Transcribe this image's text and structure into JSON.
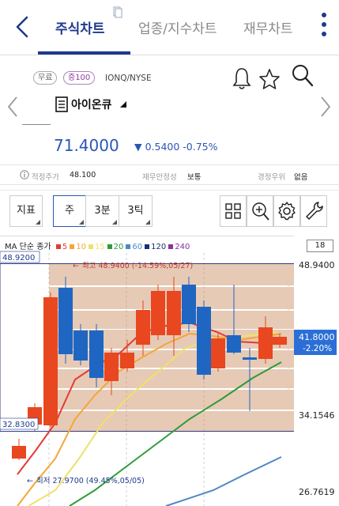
{
  "nav": {
    "tabs": [
      "주식차트",
      "업종/지수차트",
      "재무차트"
    ]
  },
  "info": {
    "badges": [
      "무료",
      "증100"
    ],
    "ticker": "IONQ/NYSE",
    "name": "아이온큐",
    "price": "71.4000",
    "change": "▼ 0.5400 -0.75%",
    "meta": [
      {
        "key": "적정주가",
        "value": "48.100"
      },
      {
        "key": "재무안정성",
        "value": "보통"
      },
      {
        "key": "경정우위",
        "value": "없음"
      }
    ]
  },
  "toolbar": {
    "indicator_label": "지표",
    "period_week": "주",
    "period_3min": "3분",
    "period_3tick": "3틱"
  },
  "chart": {
    "ma_title": "MA 단순 종가",
    "ma_lines": [
      {
        "label": "5",
        "color": "#e53935"
      },
      {
        "label": "10",
        "color": "#f4a636"
      },
      {
        "label": "15",
        "color": "#f1e06a"
      },
      {
        "label": "20",
        "color": "#2e9b3a"
      },
      {
        "label": "60",
        "color": "#4f86c9"
      },
      {
        "label": "120",
        "color": "#1a2f7a"
      },
      {
        "label": "240",
        "color": "#8b2fa0"
      }
    ],
    "period_count": "18",
    "left_top_price": "48.9200",
    "left_low_price": "32.8300",
    "right_prices": [
      "48.9400",
      "34.1546",
      "26.7619"
    ],
    "current_price_tag": "41.8000",
    "current_change_tag": "-2.20%",
    "high_annotation": "최고 48.9400 (-14.59%,05/27)",
    "low_annotation": "최저 27.9700 (49.45%,05/05)"
  },
  "chart_data": {
    "type": "candlestick",
    "y_axis_labels": [
      "48.9400",
      "34.1546",
      "26.7619"
    ],
    "high": {
      "value": 48.94,
      "label": "최고 48.9400 (-14.59%,05/27)"
    },
    "low": {
      "value": 27.97,
      "label": "최저 27.9700 (49.45%,05/05)"
    },
    "last": {
      "value": 41.8,
      "change": "-2.20%"
    },
    "series": [
      {
        "name": "MA 5"
      },
      {
        "name": "MA 10"
      },
      {
        "name": "MA 15"
      },
      {
        "name": "MA 20"
      },
      {
        "name": "MA 60"
      },
      {
        "name": "MA 120"
      },
      {
        "name": "MA 240"
      }
    ]
  }
}
